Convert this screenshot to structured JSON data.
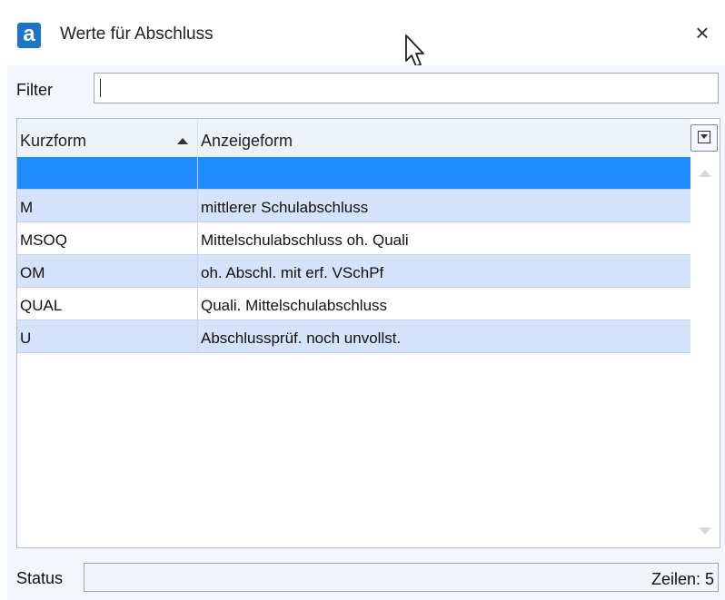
{
  "window": {
    "title": "Werte für Abschluss",
    "app_icon_letter": "a",
    "close_symbol": "×"
  },
  "filter": {
    "label": "Filter",
    "value": "",
    "placeholder": ""
  },
  "grid": {
    "columns": [
      {
        "label": "Kurzform",
        "sort": "ascending"
      },
      {
        "label": "Anzeigeform"
      }
    ],
    "rows": [
      {
        "kurzform": "",
        "anzeigeform": "",
        "state": "selected"
      },
      {
        "kurzform": "M",
        "anzeigeform": "mittlerer Schulabschluss",
        "state": "alt"
      },
      {
        "kurzform": "MSOQ",
        "anzeigeform": "Mittelschulabschluss oh. Quali",
        "state": "plain"
      },
      {
        "kurzform": "OM",
        "anzeigeform": "oh. Abschl. mit erf. VSchPf",
        "state": "alt"
      },
      {
        "kurzform": "QUAL",
        "anzeigeform": "Quali. Mittelschulabschluss",
        "state": "plain"
      },
      {
        "kurzform": "U",
        "anzeigeform": "Abschlussprüf. noch unvollst.",
        "state": "alt"
      }
    ]
  },
  "status": {
    "label": "Status",
    "rows_text": "Zeilen: 5"
  },
  "colors": {
    "selection": "#1e8cff",
    "alt_row": "#d4e2fa",
    "accent": "#1e74c8"
  },
  "icons": {
    "app": "app-logo-icon",
    "close": "close-icon",
    "columns": "column-chooser-icon",
    "cursor": "mouse-pointer-icon"
  }
}
